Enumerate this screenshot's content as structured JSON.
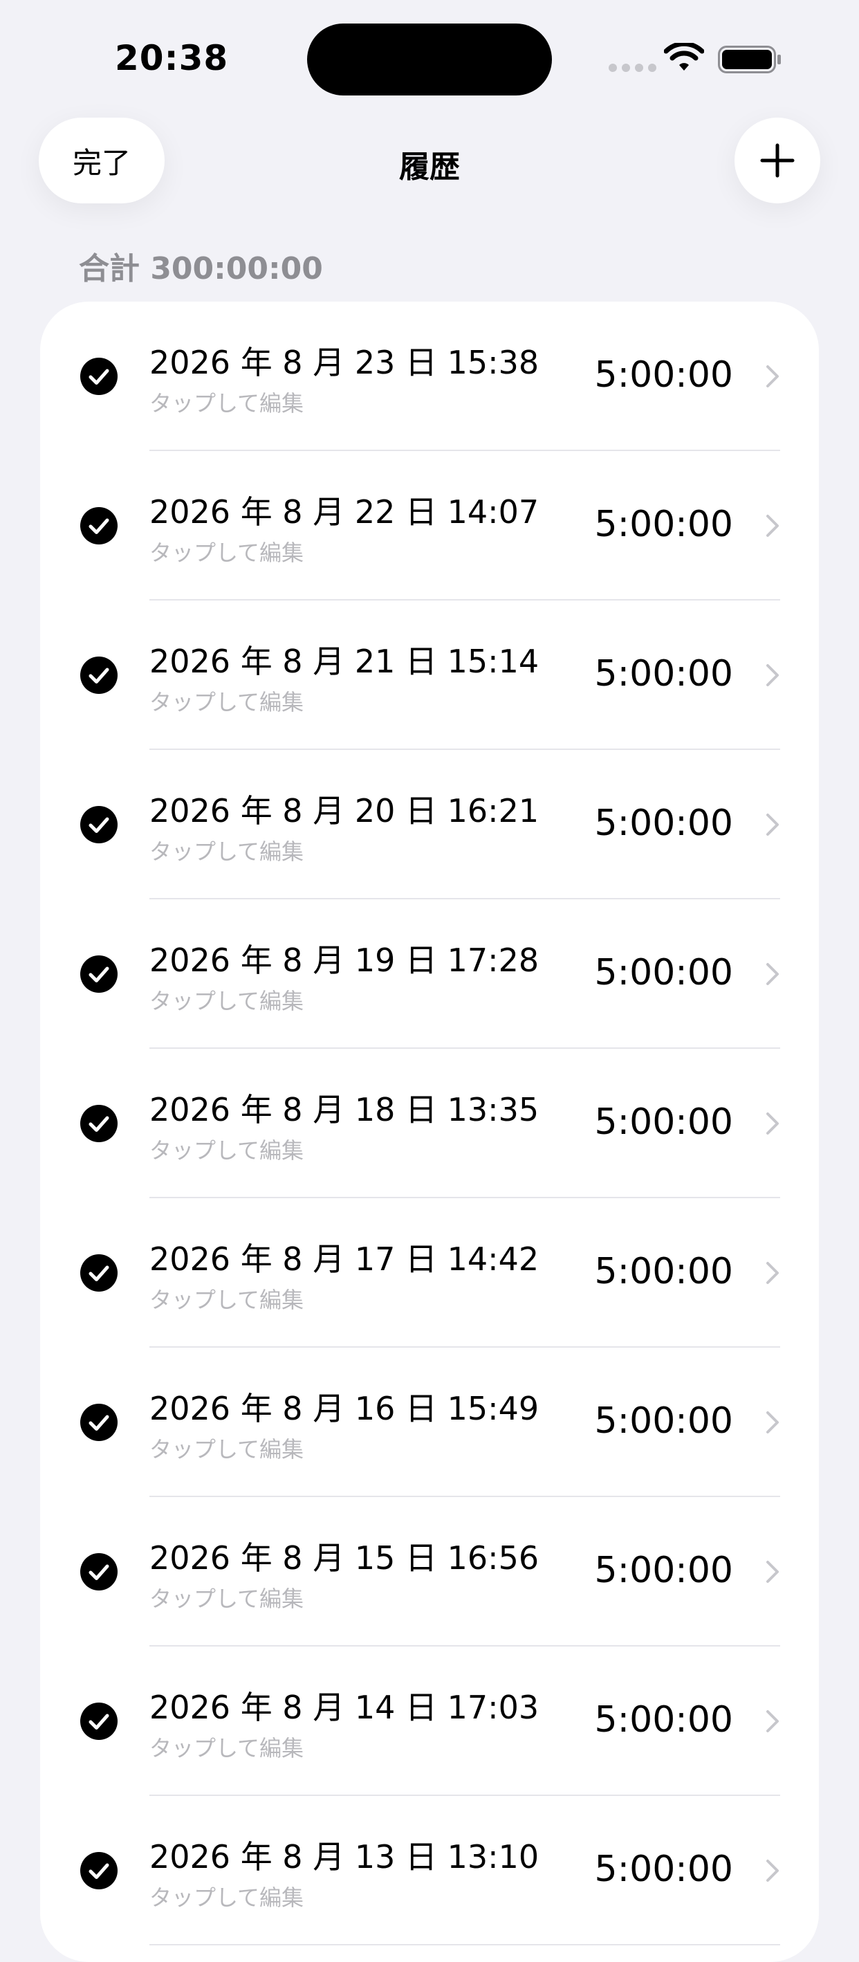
{
  "status_bar": {
    "time": "20:38"
  },
  "nav": {
    "done_label": "完了",
    "title": "履歴"
  },
  "section": {
    "total_label": "合計 300:00:00"
  },
  "entries": [
    {
      "date": "2026 年 8 月 23 日 15:38",
      "hint": "タップして編集",
      "duration": "5:00:00"
    },
    {
      "date": "2026 年 8 月 22 日 14:07",
      "hint": "タップして編集",
      "duration": "5:00:00"
    },
    {
      "date": "2026 年 8 月 21 日 15:14",
      "hint": "タップして編集",
      "duration": "5:00:00"
    },
    {
      "date": "2026 年 8 月 20 日 16:21",
      "hint": "タップして編集",
      "duration": "5:00:00"
    },
    {
      "date": "2026 年 8 月 19 日 17:28",
      "hint": "タップして編集",
      "duration": "5:00:00"
    },
    {
      "date": "2026 年 8 月 18 日 13:35",
      "hint": "タップして編集",
      "duration": "5:00:00"
    },
    {
      "date": "2026 年 8 月 17 日 14:42",
      "hint": "タップして編集",
      "duration": "5:00:00"
    },
    {
      "date": "2026 年 8 月 16 日 15:49",
      "hint": "タップして編集",
      "duration": "5:00:00"
    },
    {
      "date": "2026 年 8 月 15 日 16:56",
      "hint": "タップして編集",
      "duration": "5:00:00"
    },
    {
      "date": "2026 年 8 月 14 日 17:03",
      "hint": "タップして編集",
      "duration": "5:00:00"
    },
    {
      "date": "2026 年 8 月 13 日 13:10",
      "hint": "タップして編集",
      "duration": "5:00:00"
    }
  ],
  "icons": {
    "wifi": "wifi-icon",
    "battery": "battery-icon",
    "add": "plus-icon",
    "check": "checkmark-circle-icon",
    "chevron": "chevron-right-icon"
  },
  "colors": {
    "background": "#f2f2f7",
    "card": "#ffffff",
    "secondary_text": "#8e8e93",
    "hint_text": "#b8b8bc",
    "divider": "#e5e5ea"
  }
}
